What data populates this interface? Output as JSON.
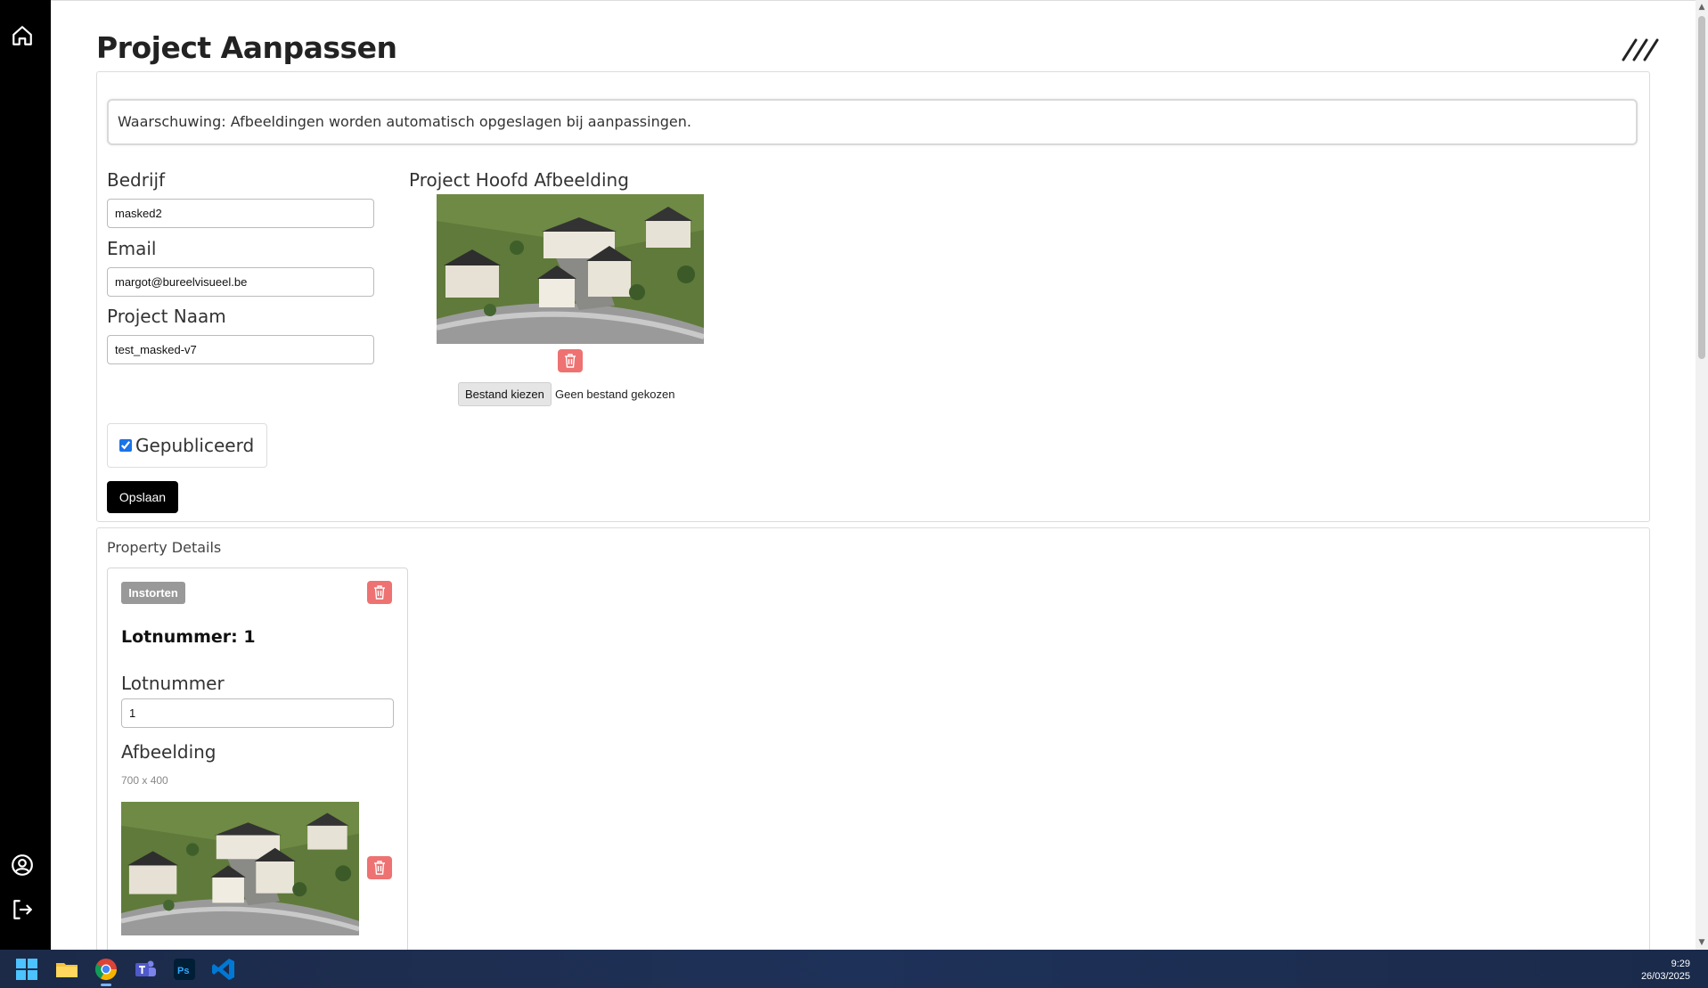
{
  "page": {
    "title": "Project Aanpassen"
  },
  "warning": "Waarschuwing: Afbeeldingen worden automatisch opgeslagen bij aanpassingen.",
  "form": {
    "company_label": "Bedrijf",
    "company_value": "masked2",
    "email_label": "Email",
    "email_value": "margot@bureelvisueel.be",
    "project_name_label": "Project Naam",
    "project_name_value": "test_masked-v7",
    "main_image_label": "Project Hoofd Afbeelding",
    "file_button": "Bestand kiezen",
    "file_status": "Geen bestand gekozen",
    "published_label": "Gepubliceerd",
    "published_checked": true,
    "save_button": "Opslaan"
  },
  "property": {
    "section_title": "Property Details",
    "collapse_button": "Instorten",
    "lot_heading": "Lotnummer: 1",
    "lot_label": "Lotnummer",
    "lot_value": "1",
    "image_label": "Afbeelding",
    "image_dimensions": "700 x 400"
  },
  "taskbar": {
    "time": "9:29",
    "date": "26/03/2025",
    "apps": [
      "windows-start-icon",
      "file-explorer-icon",
      "chrome-icon",
      "teams-icon",
      "photoshop-icon",
      "vscode-icon"
    ]
  },
  "colors": {
    "sidebar": "#000000",
    "delete": "#ee7272",
    "save": "#000000",
    "collapse": "#999999",
    "taskbar": "#1e3158"
  },
  "icons": {
    "sidebar_top": "home-icon",
    "sidebar_bottom": [
      "user-circle-icon",
      "logout-icon"
    ],
    "menu": "hamburger-slash-icon",
    "delete": "trash-icon"
  }
}
